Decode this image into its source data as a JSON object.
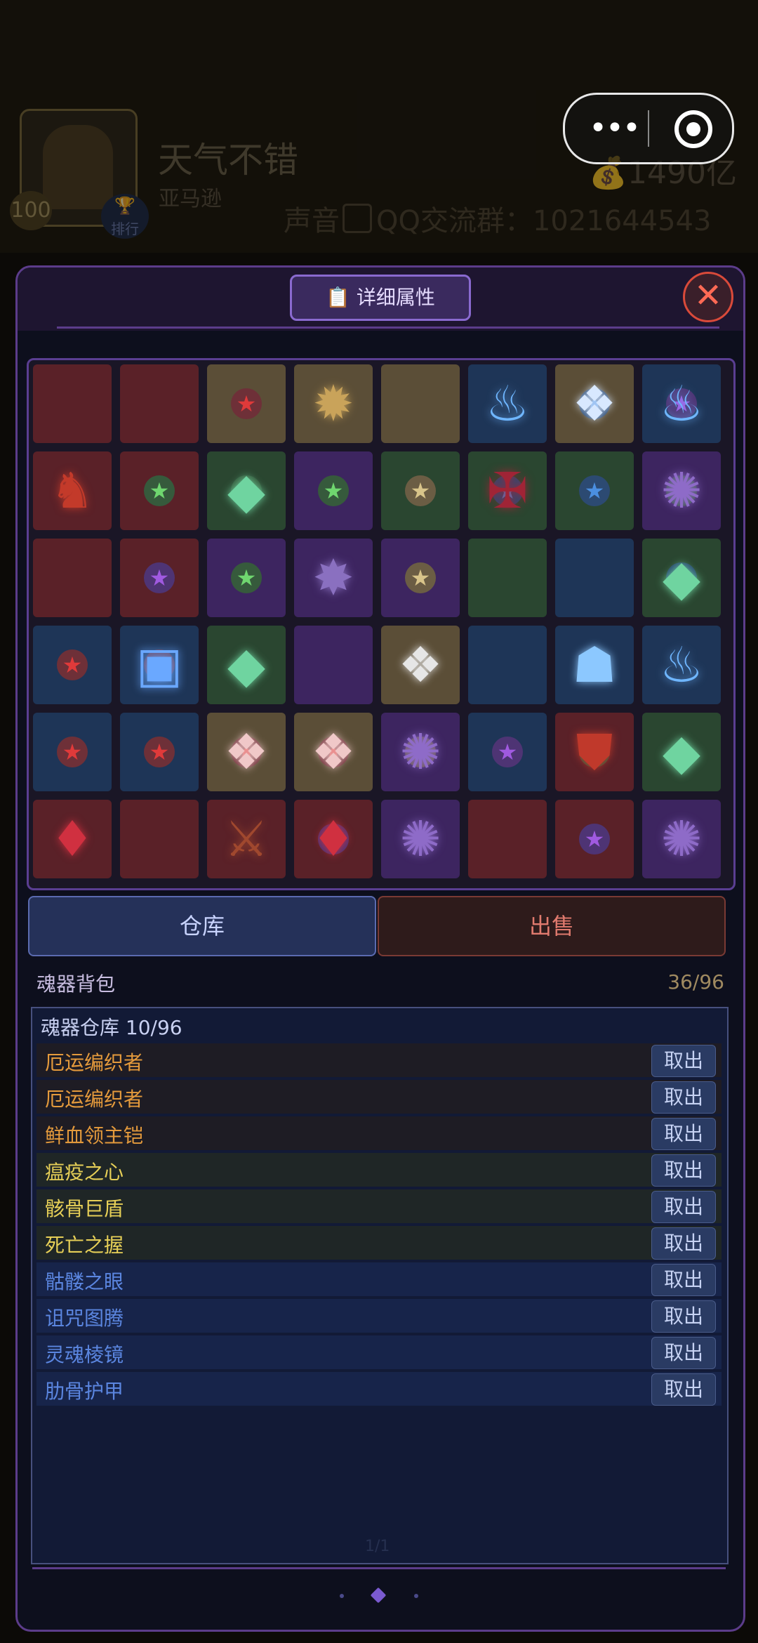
{
  "header": {
    "player_name": "天气不错",
    "player_sub": "亚马逊",
    "level": "100",
    "rank_label": "排行",
    "gold": "1490亿",
    "sound_label": "声音",
    "qq_text": "QQ交流群：1021644543"
  },
  "modal": {
    "detail_label": "详细属性",
    "close_glyph": "✕"
  },
  "tabs": {
    "store": "仓库",
    "sell": "出售"
  },
  "bag": {
    "title": "魂器背包",
    "count": "36/96"
  },
  "warehouse": {
    "title": "魂器仓库 10/96",
    "take_label": "取出",
    "items": [
      {
        "name": "厄运编织者",
        "color": "#e49a3c"
      },
      {
        "name": "厄运编织者",
        "color": "#e49a3c"
      },
      {
        "name": "鲜血领主铠",
        "color": "#e49a3c"
      },
      {
        "name": "瘟疫之心",
        "color": "#e6cf57"
      },
      {
        "name": "骸骨巨盾",
        "color": "#e6cf57"
      },
      {
        "name": "死亡之握",
        "color": "#e6cf57"
      },
      {
        "name": "骷髅之眼",
        "color": "#5b86e0"
      },
      {
        "name": "诅咒图腾",
        "color": "#5b86e0"
      },
      {
        "name": "灵魂棱镜",
        "color": "#5b86e0"
      },
      {
        "name": "肋骨护甲",
        "color": "#5b86e0"
      }
    ],
    "page_indicator": "1/1"
  },
  "grid": {
    "rows": [
      [
        "red",
        "red",
        "tan",
        "tan",
        "tan",
        "blue",
        "tan",
        "blue"
      ],
      [
        "red",
        "red",
        "green",
        "purple",
        "green",
        "green",
        "green",
        "purple"
      ],
      [
        "red",
        "red",
        "purple",
        "purple",
        "purple",
        "green",
        "blue",
        "green"
      ],
      [
        "blue",
        "blue",
        "green",
        "purple",
        "tan",
        "blue",
        "blue",
        "blue"
      ],
      [
        "blue",
        "blue",
        "tan",
        "tan",
        "purple",
        "blue",
        "red",
        "green"
      ],
      [
        "red",
        "red",
        "red",
        "red",
        "purple",
        "red",
        "red",
        "purple"
      ]
    ],
    "stars": [
      {
        "r": 0,
        "c": 2,
        "color": "red"
      },
      {
        "r": 0,
        "c": 6,
        "color": "blue"
      },
      {
        "r": 0,
        "c": 7,
        "color": "purple"
      },
      {
        "r": 1,
        "c": 1,
        "color": "green"
      },
      {
        "r": 1,
        "c": 2,
        "color": "green"
      },
      {
        "r": 1,
        "c": 3,
        "color": "green"
      },
      {
        "r": 1,
        "c": 4,
        "color": "tan"
      },
      {
        "r": 1,
        "c": 5,
        "color": "blue"
      },
      {
        "r": 1,
        "c": 6,
        "color": "blue"
      },
      {
        "r": 1,
        "c": 7,
        "color": "green"
      },
      {
        "r": 2,
        "c": 1,
        "color": "purple"
      },
      {
        "r": 2,
        "c": 2,
        "color": "green"
      },
      {
        "r": 2,
        "c": 4,
        "color": "tan"
      },
      {
        "r": 2,
        "c": 7,
        "color": "blue"
      },
      {
        "r": 3,
        "c": 0,
        "color": "red"
      },
      {
        "r": 3,
        "c": 1,
        "color": "red"
      },
      {
        "r": 4,
        "c": 0,
        "color": "red"
      },
      {
        "r": 4,
        "c": 1,
        "color": "red"
      },
      {
        "r": 4,
        "c": 2,
        "color": "red"
      },
      {
        "r": 4,
        "c": 3,
        "color": "red"
      },
      {
        "r": 4,
        "c": 4,
        "color": "tan"
      },
      {
        "r": 4,
        "c": 5,
        "color": "purple"
      },
      {
        "r": 4,
        "c": 6,
        "color": "green"
      },
      {
        "r": 5,
        "c": 3,
        "color": "purple"
      },
      {
        "r": 5,
        "c": 6,
        "color": "purple"
      }
    ],
    "items": [
      {
        "r": 0,
        "c": 3,
        "icon": "bone-spine",
        "glyph": "✹",
        "color": "#c9a35a"
      },
      {
        "r": 0,
        "c": 5,
        "icon": "blue-flame-totem",
        "glyph": "♨",
        "color": "#6fb6ff"
      },
      {
        "r": 0,
        "c": 6,
        "icon": "crystal-shard",
        "glyph": "❖",
        "color": "#d8e8ff"
      },
      {
        "r": 0,
        "c": 7,
        "icon": "blue-flame-totem",
        "glyph": "♨",
        "color": "#6fb6ff"
      },
      {
        "r": 1,
        "c": 0,
        "icon": "blood-lord-armor",
        "glyph": "♞",
        "color": "#c33a2a"
      },
      {
        "r": 1,
        "c": 2,
        "icon": "green-gem",
        "glyph": "◆",
        "color": "#6fd4a0"
      },
      {
        "r": 1,
        "c": 5,
        "icon": "blood-cross",
        "glyph": "✠",
        "color": "#a02436"
      },
      {
        "r": 1,
        "c": 7,
        "icon": "purple-rune-orb",
        "glyph": "✺",
        "color": "#8e6bc8"
      },
      {
        "r": 2,
        "c": 3,
        "icon": "dark-star-sigil",
        "glyph": "✸",
        "color": "#8a70c0"
      },
      {
        "r": 2,
        "c": 7,
        "icon": "green-gem",
        "glyph": "◆",
        "color": "#6fd4a0"
      },
      {
        "r": 3,
        "c": 1,
        "icon": "blue-chest",
        "glyph": "▣",
        "color": "#6aa8ff"
      },
      {
        "r": 3,
        "c": 2,
        "icon": "green-gem",
        "glyph": "◆",
        "color": "#6fd4a0"
      },
      {
        "r": 3,
        "c": 4,
        "icon": "crystal-shard",
        "glyph": "❖",
        "color": "#e6e6e6"
      },
      {
        "r": 3,
        "c": 6,
        "icon": "lantern",
        "glyph": "☗",
        "color": "#8cc8ff"
      },
      {
        "r": 3,
        "c": 7,
        "icon": "blue-flame-totem",
        "glyph": "♨",
        "color": "#6fb6ff"
      },
      {
        "r": 4,
        "c": 2,
        "icon": "crystal-shard",
        "glyph": "❖",
        "color": "#f0c8c8"
      },
      {
        "r": 4,
        "c": 3,
        "icon": "crystal-shard",
        "glyph": "❖",
        "color": "#f0c8c8"
      },
      {
        "r": 4,
        "c": 4,
        "icon": "purple-rune-orb",
        "glyph": "✺",
        "color": "#8e6bc8"
      },
      {
        "r": 4,
        "c": 6,
        "icon": "blood-shield",
        "glyph": "⛊",
        "color": "#c0392b"
      },
      {
        "r": 4,
        "c": 7,
        "icon": "green-gem",
        "glyph": "◆",
        "color": "#6fd4a0"
      },
      {
        "r": 5,
        "c": 0,
        "icon": "red-teardrop-amulet",
        "glyph": "♦",
        "color": "#d03040"
      },
      {
        "r": 5,
        "c": 2,
        "icon": "bone-dagger",
        "glyph": "⚔",
        "color": "#a0482e"
      },
      {
        "r": 5,
        "c": 3,
        "icon": "red-teardrop-amulet",
        "glyph": "♦",
        "color": "#d03040"
      },
      {
        "r": 5,
        "c": 4,
        "icon": "purple-rune-orb",
        "glyph": "✺",
        "color": "#8e6bc8"
      },
      {
        "r": 5,
        "c": 7,
        "icon": "purple-rune-orb",
        "glyph": "✺",
        "color": "#8e6bc8"
      }
    ],
    "palette": {
      "red": {
        "bg": "#5a2128",
        "star": "#e03a3a",
        "ring": "#6e3038"
      },
      "tan": {
        "bg": "#5b4e37",
        "star": "#d8c48a",
        "ring": "#6b5d44"
      },
      "blue": {
        "bg": "#1e3557",
        "star": "#4b8fe0",
        "ring": "#2c4a72"
      },
      "green": {
        "bg": "#2a4630",
        "star": "#6fd66f",
        "ring": "#365a3c"
      },
      "purple": {
        "bg": "#3d2560",
        "star": "#a05ae0",
        "ring": "#4e3474"
      }
    }
  }
}
